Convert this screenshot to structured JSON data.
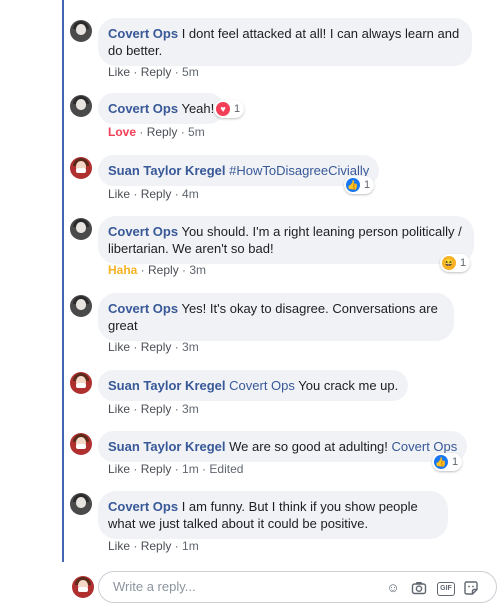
{
  "actions": {
    "like": "Like",
    "reply": "Reply",
    "love": "Love",
    "haha": "Haha",
    "sep": " · ",
    "edited": "Edited"
  },
  "comments": [
    {
      "author": "Covert Ops",
      "text": "I dont feel attacked at all! I can always learn and do better.",
      "time": "5m"
    },
    {
      "author": "Covert Ops",
      "text": "Yeah!",
      "time": "5m",
      "reaction_count": "1"
    },
    {
      "author": "Suan Taylor Kregel",
      "text": "#HowToDisagreeCivially",
      "time": "4m",
      "reaction_count": "1"
    },
    {
      "author": "Covert Ops",
      "text": "You should. I'm a right leaning person politically / libertarian. We aren't so bad!",
      "time": "3m",
      "reaction_count": "1"
    },
    {
      "author": "Covert Ops",
      "text": "Yes! It's okay to disagree. Conversations are great",
      "time": "3m"
    },
    {
      "author": "Suan Taylor Kregel",
      "mention": "Covert Ops",
      "text": "You crack me up.",
      "time": "3m"
    },
    {
      "author": "Suan Taylor Kregel",
      "text": "We are so good at adulting!",
      "mention": "Covert Ops",
      "time": "1m",
      "reaction_count": "1"
    },
    {
      "author": "Covert Ops",
      "text": "I am funny. But I think if you show people what we just talked about it could be positive.",
      "time": "1m"
    }
  ],
  "reply": {
    "placeholder": "Write a reply..."
  },
  "colors": {
    "thread": "#4267b2",
    "name": "#385898",
    "love": "#f33e58",
    "haha": "#f7b125",
    "like": "#1877f2"
  }
}
